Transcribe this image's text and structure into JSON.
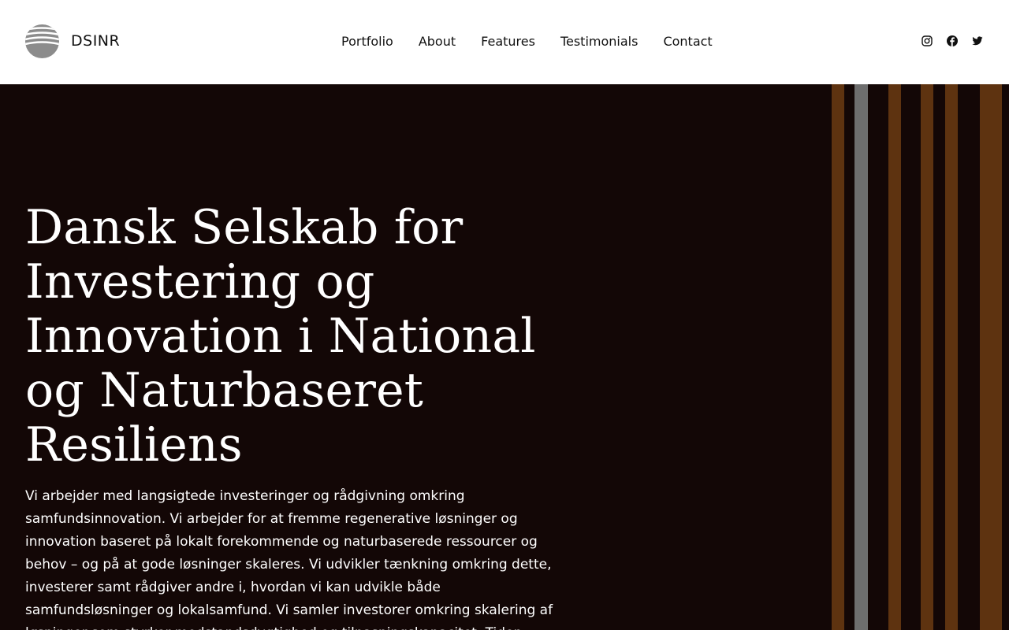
{
  "header": {
    "brand": "DSINR",
    "nav": [
      "Portfolio",
      "About",
      "Features",
      "Testimonials",
      "Contact"
    ],
    "socials": [
      "instagram-icon",
      "facebook-icon",
      "twitter-icon"
    ]
  },
  "hero": {
    "title": "Dansk Selskab for Investering og Innovation i National og Naturbaseret Resiliens",
    "body": "Vi arbejder med langsigtede investeringer og rådgivning omkring samfundsinnovation. Vi arbejder for at fremme regenerative løsninger og innovation baseret på lokalt forekommende og naturbaserede ressourcer og behov – og på at gode løsninger skaleres. Vi udvikler tænkning omkring dette, investerer samt rådgiver andre i, hvordan vi kan udvikle både samfundsløsninger og lokalsamfund. Vi samler investorer omkring skalering af løsninger som styrker modstandsdygtighed og tilpasningskapacitet. Tiden"
  },
  "colors": {
    "hero_background": "#130706",
    "stripe_brown": "#5e3310",
    "stripe_gray": "#6e6e6e",
    "text_dark": "#111111",
    "text_light": "#ffffff"
  }
}
